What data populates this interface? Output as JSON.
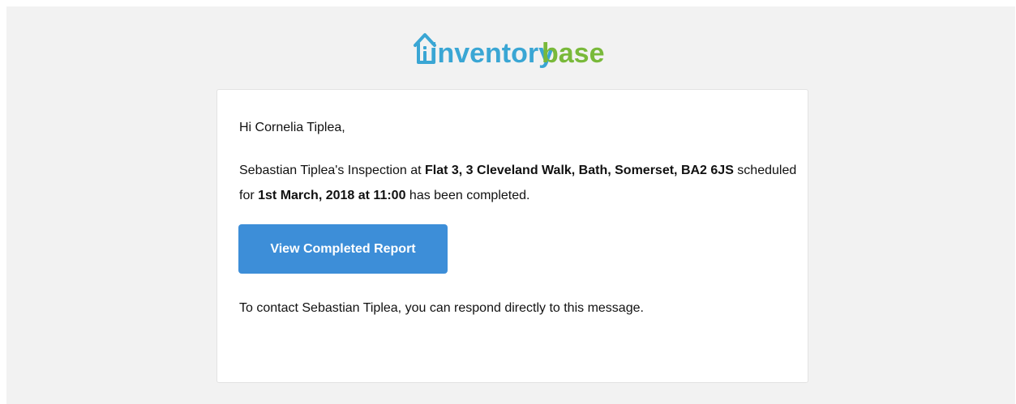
{
  "brand": {
    "logo_part1": "inventory",
    "logo_part2": "base",
    "color_part1": "#3aa6d4",
    "color_part2": "#79b93a"
  },
  "email": {
    "greeting": "Hi Cornelia Tiplea,",
    "message": {
      "prefix": "Sebastian Tiplea's Inspection at ",
      "address": "Flat 3, 3 Cleveland Walk, Bath, Somerset, BA2 6JS",
      "middle": " scheduled for ",
      "datetime": "1st March, 2018 at 11:00",
      "suffix": " has been completed."
    },
    "button_label": "View Completed Report",
    "button_color": "#3d8ed8",
    "contact_text": "To contact Sebastian Tiplea, you can respond directly to this message."
  }
}
